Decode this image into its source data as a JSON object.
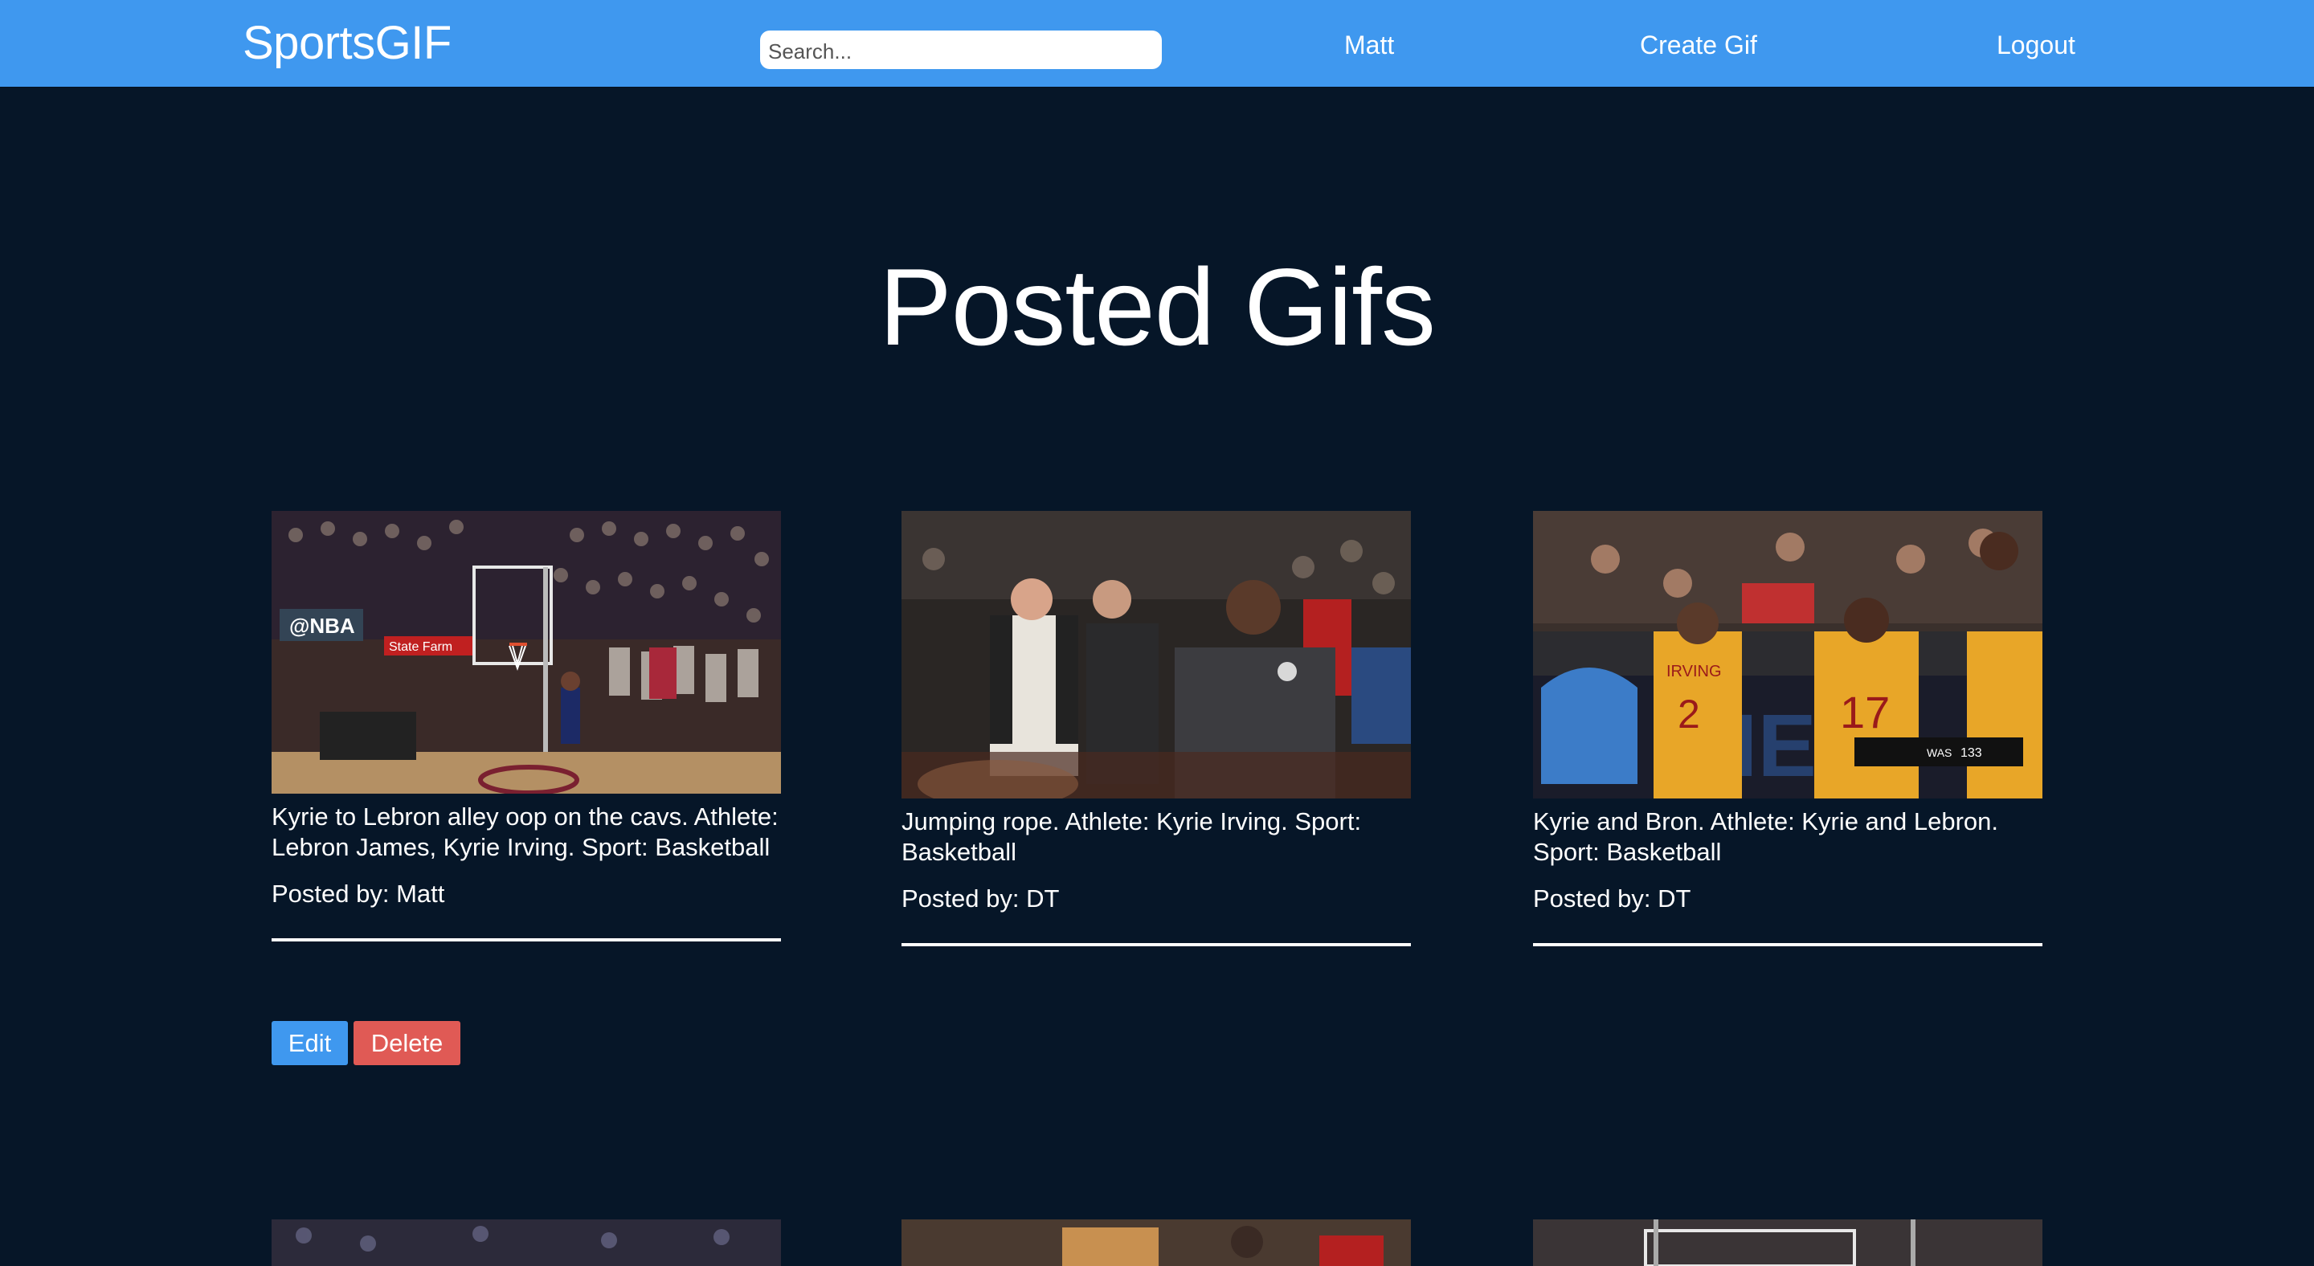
{
  "navbar": {
    "brand": "SportsGIF",
    "search_placeholder": "Search...",
    "user_link": "Matt",
    "create_link": "Create Gif",
    "logout_link": "Logout",
    "color": "#3f98ef"
  },
  "page": {
    "title": "Posted Gifs",
    "background": "#061628"
  },
  "posts": [
    {
      "caption": "Kyrie to Lebron alley oop on the cavs. Athlete: Lebron James, Kyrie Irving. Sport: Basketball",
      "posted_by": "Posted by: Matt",
      "edit_label": "Edit",
      "delete_label": "Delete"
    },
    {
      "caption": "Jumping rope. Athlete: Kyrie Irving. Sport: Basketball",
      "posted_by": "Posted by: DT"
    },
    {
      "caption": "Kyrie and Bron. Athlete: Kyrie and Lebron. Sport: Basketball",
      "posted_by": "Posted by: DT"
    }
  ],
  "thumb_text": {
    "nba": "@NBA",
    "statefarm": "State Farm",
    "jersey_name": "IRVING",
    "jersey_num_1": "2",
    "jersey_num_2": "17",
    "score_team": "WAS",
    "score_value": "133"
  },
  "colors": {
    "edit_button": "#3f98ef",
    "delete_button": "#e05a55"
  }
}
